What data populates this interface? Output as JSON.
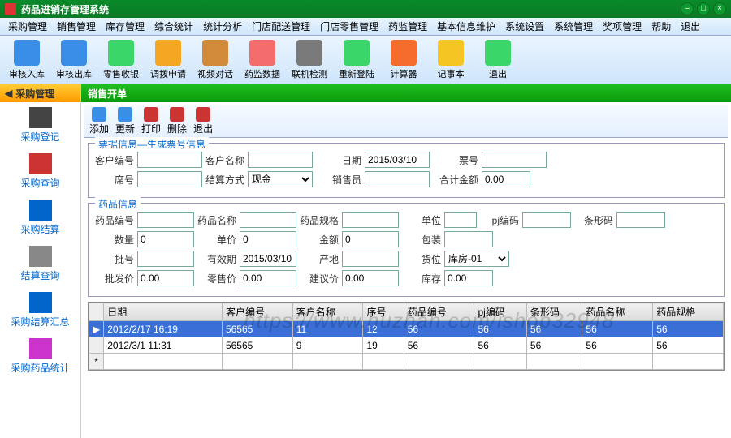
{
  "app_title": "药品进销存管理系统",
  "menubar": [
    "采购管理",
    "销售管理",
    "库存管理",
    "综合统计",
    "统计分析",
    "门店配送管理",
    "门店零售管理",
    "药监管理",
    "基本信息维护",
    "系统设置",
    "系统管理",
    "奖项管理",
    "帮助",
    "退出"
  ],
  "toolbar": [
    {
      "label": "审核入库",
      "icon": "#3a8ee6"
    },
    {
      "label": "审核出库",
      "icon": "#3a8ee6"
    },
    {
      "label": "零售收银",
      "icon": "#3ad66a"
    },
    {
      "label": "调拨申请",
      "icon": "#f5a623"
    },
    {
      "label": "视频对话",
      "icon": "#d08a3a"
    },
    {
      "label": "药监数据",
      "icon": "#f56c6c"
    },
    {
      "label": "联机检测",
      "icon": "#7a7a7a"
    },
    {
      "label": "重新登陆",
      "icon": "#3ad66a"
    },
    {
      "label": "计算器",
      "icon": "#f56c2c"
    },
    {
      "label": "记事本",
      "icon": "#f5c623"
    },
    {
      "label": "退出",
      "icon": "#3ad66a"
    }
  ],
  "sidebar_title": "采购管理",
  "sidebar": [
    {
      "label": "采购登记",
      "icon": "#444"
    },
    {
      "label": "采购查询",
      "icon": "#c33"
    },
    {
      "label": "采购结算",
      "icon": "#06c"
    },
    {
      "label": "结算查询",
      "icon": "#888"
    },
    {
      "label": "采购结算汇总",
      "icon": "#06c"
    },
    {
      "label": "采购药品统计",
      "icon": "#c3c"
    }
  ],
  "current_tab": "销售开单",
  "inner_toolbar": [
    {
      "label": "添加",
      "icon": "#3a8ee6"
    },
    {
      "label": "更新",
      "icon": "#3a8ee6"
    },
    {
      "label": "打印",
      "icon": "#c33"
    },
    {
      "label": "删除",
      "icon": "#c33"
    },
    {
      "label": "退出",
      "icon": "#c33"
    }
  ],
  "group1": {
    "title": "票据信息—生成票号信息",
    "labels": {
      "客户编号": "客户编号",
      "客户名称": "客户名称",
      "日期": "日期",
      "票号": "票号",
      "席号": "席号",
      "结算方式": "结算方式",
      "销售员": "销售员",
      "合计金额": "合计金额"
    },
    "values": {
      "date": "2015/03/10",
      "settle": "现金",
      "total": "0.00"
    }
  },
  "group2": {
    "title": "药品信息",
    "labels": {
      "药品编号": "药品编号",
      "药品名称": "药品名称",
      "药品规格": "药品规格",
      "单位": "单位",
      "pj编码": "pj编码",
      "条形码": "条形码",
      "数量": "数量",
      "单价": "单价",
      "金额": "金额",
      "包装": "包装",
      "批号": "批号",
      "有效期": "有效期",
      "产地": "产地",
      "货位": "货位",
      "批发价": "批发价",
      "零售价": "零售价",
      "建议价": "建议价",
      "库存": "库存"
    },
    "values": {
      "qty": "0",
      "price": "0",
      "amount": "0",
      "valid": "2015/03/10",
      "loc": "库房-01",
      "wprice": "0.00",
      "rprice": "0.00",
      "sugprice": "0.00",
      "stock": "0.00"
    }
  },
  "grid": {
    "columns": [
      "日期",
      "客户编号",
      "客户名称",
      "序号",
      "药品编号",
      "pj编码",
      "条形码",
      "药品名称",
      "药品规格"
    ],
    "rows": [
      [
        "2012/2/17 16:19",
        "56565",
        "11",
        "12",
        "56",
        "56",
        "56",
        "56",
        "56"
      ],
      [
        "2012/3/1 11:31",
        "56565",
        "9",
        "19",
        "56",
        "56",
        "56",
        "56",
        "56"
      ]
    ]
  },
  "watermark": "https://www.huzhan.com/ishop32948"
}
